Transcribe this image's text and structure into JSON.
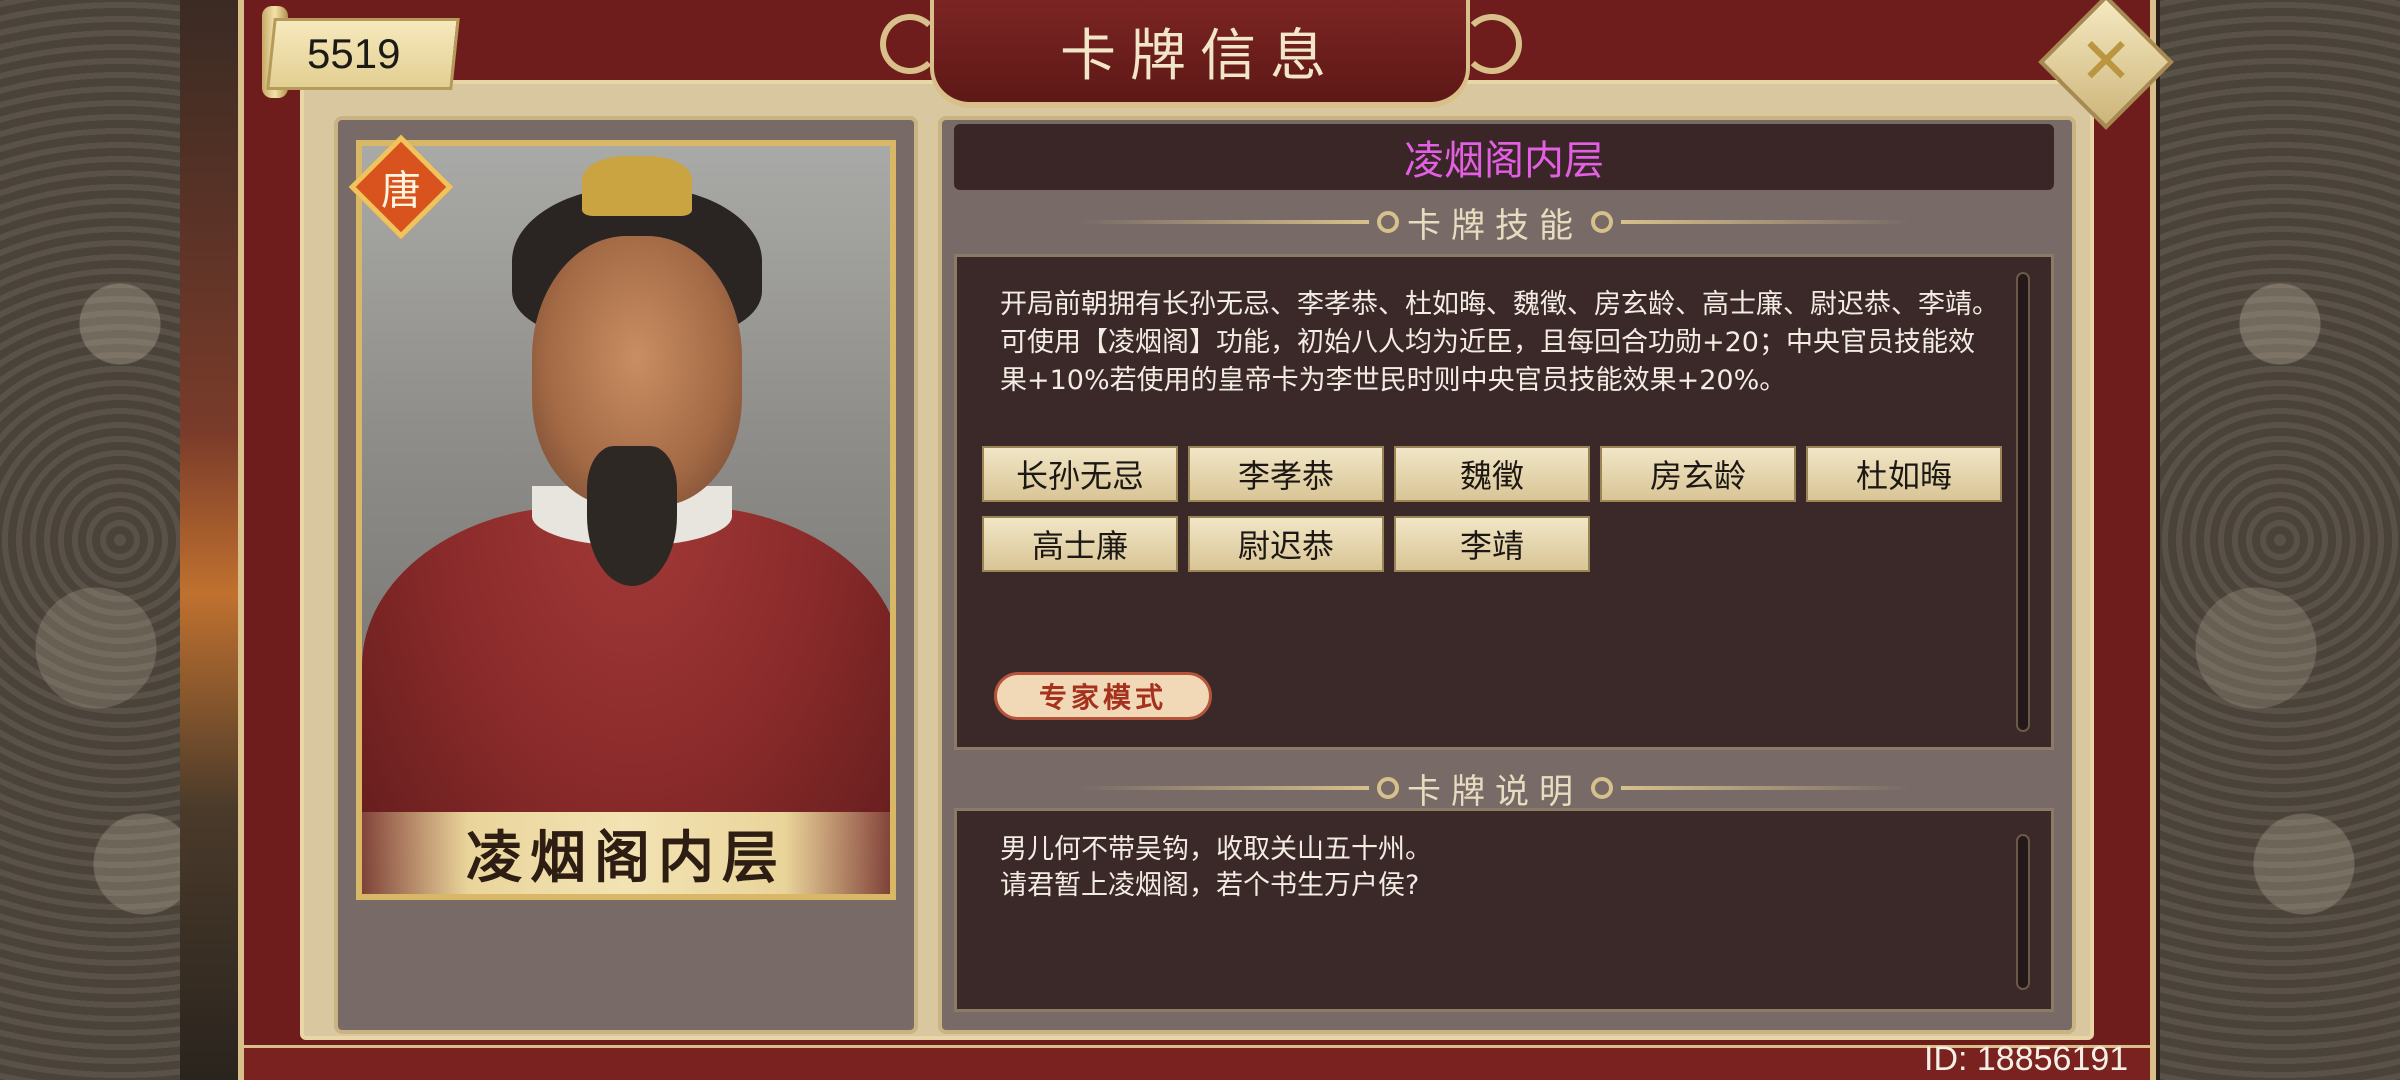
{
  "currency": {
    "amount": "5519"
  },
  "header": {
    "title": "卡牌信息"
  },
  "card": {
    "faction_badge": "唐",
    "portrait_name": "凌烟阁内层",
    "name": "凌烟阁内层"
  },
  "skill_section": {
    "heading": "卡牌技能",
    "description": "开局前朝拥有长孙无忌、李孝恭、杜如晦、魏徵、房玄龄、高士廉、尉迟恭、李靖。可使用【凌烟阁】功能，初始八人均为近臣，且每回合功勋+20；中央官员技能效果+10%若使用的皇帝卡为李世民时则中央官员技能效果+20%。",
    "officials": [
      "长孙无忌",
      "李孝恭",
      "魏徵",
      "房玄龄",
      "杜如晦",
      "高士廉",
      "尉迟恭",
      "李靖"
    ],
    "mode_badge": "专家模式"
  },
  "description_section": {
    "heading": "卡牌说明",
    "text": "男儿何不带吴钩，收取关山五十州。\n请君暂上凌烟阁，若个书生万户侯?"
  },
  "footer": {
    "player_id": "ID: 18856191"
  },
  "colors": {
    "card_name": "#e35fe3",
    "frame": "#6e1d1c",
    "gold": "#d9c08a"
  }
}
